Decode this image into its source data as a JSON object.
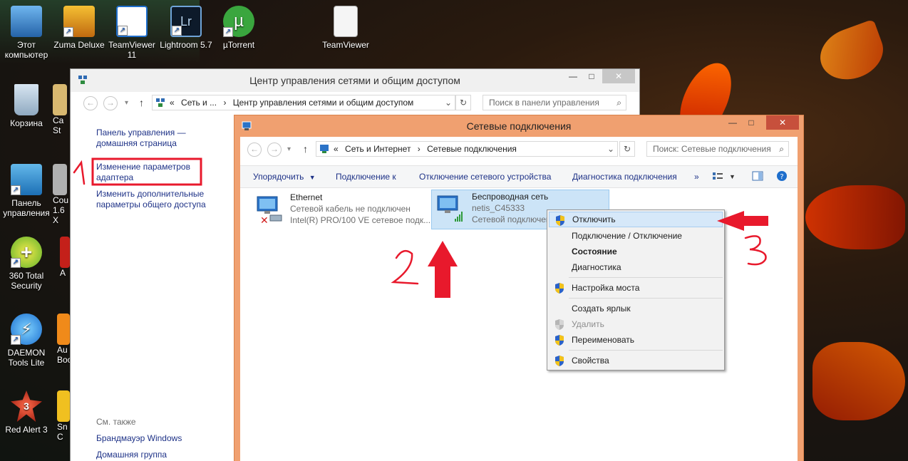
{
  "desktop": {
    "icons": [
      {
        "label": "Этот компьютер"
      },
      {
        "label": "Zuma Deluxe"
      },
      {
        "label": "TeamViewer 11"
      },
      {
        "label": "Lightroom 5.7"
      },
      {
        "label": "µTorrent"
      },
      {
        "label": "TeamViewer"
      },
      {
        "label": "Корзина"
      },
      {
        "label": "Панель управления"
      },
      {
        "label": "360 Total Security"
      },
      {
        "label": "DAEMON Tools Lite"
      },
      {
        "label": "Red Alert 3"
      },
      {
        "label": "Ca St"
      },
      {
        "label": "Cou 1.6 X"
      },
      {
        "label": "A"
      },
      {
        "label": "Au Boo"
      },
      {
        "label": "Sn C"
      }
    ]
  },
  "back_window": {
    "title": "Центр управления сетями и общим доступом",
    "address": {
      "prefix": "«",
      "crumb1": "Сеть и ...",
      "sep": "›",
      "crumb2": "Центр управления сетями и общим доступом"
    },
    "search_placeholder": "Поиск в панели управления",
    "left_links": [
      "Панель управления — домашняя страница",
      "Изменение параметров адаптера",
      "Изменить дополнительные параметры общего доступа"
    ],
    "see_also_title": "См. также",
    "see_also": [
      "Брандмауэр Windows",
      "Домашняя группа"
    ]
  },
  "front_window": {
    "title": "Сетевые подключения",
    "address": {
      "prefix": "«",
      "crumb1": "Сеть и Интернет",
      "sep": "›",
      "crumb2": "Сетевые подключения"
    },
    "search_placeholder": "Поиск: Сетевые подключения",
    "commands": [
      "Упорядочить",
      "Подключение к",
      "Отключение сетевого устройства",
      "Диагностика подключения",
      "»"
    ],
    "adapters": [
      {
        "name": "Ethernet",
        "status": "Сетевой кабель не подключен",
        "device": "Intel(R) PRO/100 VE сетевое подк..."
      },
      {
        "name": "Беспроводная сеть",
        "status": "netis_C45333",
        "device": "Сетевой подключен"
      }
    ]
  },
  "context_menu": {
    "items": [
      {
        "label": "Отключить",
        "shield": true
      },
      {
        "label": "Подключение / Отключение",
        "shield": false
      },
      {
        "label": "Состояние",
        "shield": false
      },
      {
        "label": "Диагностика",
        "shield": false
      },
      {
        "label": "Настройка моста",
        "shield": true
      },
      {
        "label": "Создать ярлык",
        "shield": false
      },
      {
        "label": "Удалить",
        "shield": true
      },
      {
        "label": "Переименовать",
        "shield": true
      },
      {
        "label": "Свойства",
        "shield": true
      }
    ]
  },
  "annotations": {
    "colors": {
      "red": "#e8192c"
    }
  },
  "colors": {
    "link": "#1e3287",
    "front_titlebar": "#f0a070",
    "selection": "#cce4f7",
    "menu_highlight": "#d6e8f9"
  }
}
